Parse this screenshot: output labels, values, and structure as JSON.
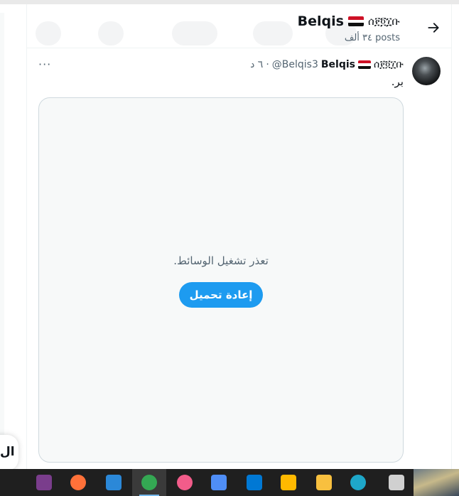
{
  "header": {
    "prefix_glyphs": "ሰ፻፬፲ቡ",
    "name": "Belqis",
    "posts_count": "٣٤ ألف posts",
    "back_icon": "arrow-right-icon"
  },
  "tweet": {
    "display_prefix": "ሰ፻፬፲ቡ",
    "display_name": "Belqis",
    "handle": "@Belqis3",
    "separator": "·",
    "time": "٦ د",
    "text": "بر.",
    "more_label": "···"
  },
  "media": {
    "error_message": "تعذر تشغيل الوسائط.",
    "reload_label": "إعادة تحميل"
  },
  "left_panel": {
    "partial_text": "ال"
  },
  "colors": {
    "accent": "#1d9bf0",
    "flag_red": "#ce1126",
    "flag_white": "#ffffff",
    "flag_black": "#111111"
  },
  "taskbar": {
    "apps": [
      {
        "name": "winrar-icon",
        "color": "#7a3d8c",
        "active": false
      },
      {
        "name": "firefox-icon",
        "color": "#ff7139",
        "active": false
      },
      {
        "name": "movies-tv-icon",
        "color": "#2b88d8",
        "active": false
      },
      {
        "name": "chrome-icon",
        "color": "#34a853",
        "active": true
      },
      {
        "name": "itunes-icon",
        "color": "#f25c8a",
        "active": false
      },
      {
        "name": "copilot-icon",
        "color": "#4f8ef7",
        "active": false
      },
      {
        "name": "mail-icon",
        "color": "#0078d4",
        "active": false
      },
      {
        "name": "microsoft-store-icon",
        "color": "#ffb900",
        "active": false
      },
      {
        "name": "file-explorer-icon",
        "color": "#f8c03f",
        "active": false
      },
      {
        "name": "edge-icon",
        "color": "#1ea7c9",
        "active": false
      },
      {
        "name": "task-view-icon",
        "color": "#d0d0d0",
        "active": false
      }
    ]
  }
}
